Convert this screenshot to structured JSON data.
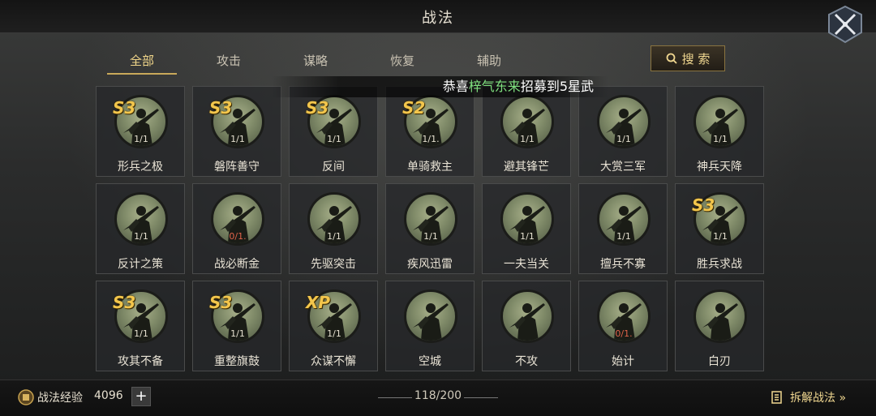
{
  "title": "战法",
  "tabs": [
    {
      "label": "全部",
      "active": true
    },
    {
      "label": "攻击",
      "active": false
    },
    {
      "label": "谋略",
      "active": false
    },
    {
      "label": "恢复",
      "active": false
    },
    {
      "label": "辅助",
      "active": false
    }
  ],
  "search_label": "搜 索",
  "notice": {
    "prefix": "恭喜",
    "highlight": "梓气东来",
    "suffix": "招募到5星武"
  },
  "skills": [
    {
      "name": "形兵之极",
      "count": "1/1",
      "badge": "S3",
      "red": false
    },
    {
      "name": "磐阵善守",
      "count": "1/1",
      "badge": "S3",
      "red": false
    },
    {
      "name": "反间",
      "count": "1/1",
      "badge": "S3",
      "red": false
    },
    {
      "name": "单骑救主",
      "count": "1/1.",
      "badge": "S2",
      "red": false
    },
    {
      "name": "避其锋芒",
      "count": "1/1",
      "badge": "",
      "red": false
    },
    {
      "name": "大赏三军",
      "count": "1/1",
      "badge": "",
      "red": false
    },
    {
      "name": "神兵天降",
      "count": "1/1",
      "badge": "",
      "red": false
    },
    {
      "name": "反计之策",
      "count": "1/1",
      "badge": "",
      "red": false
    },
    {
      "name": "战必断金",
      "count": "0/1.",
      "badge": "",
      "red": true
    },
    {
      "name": "先驱突击",
      "count": "1/1",
      "badge": "",
      "red": false
    },
    {
      "name": "疾风迅雷",
      "count": "1/1",
      "badge": "",
      "red": false
    },
    {
      "name": "一夫当关",
      "count": "1/1",
      "badge": "",
      "red": false
    },
    {
      "name": "擅兵不寡",
      "count": "1/1",
      "badge": "",
      "red": false
    },
    {
      "name": "胜兵求战",
      "count": "1/1",
      "badge": "S3",
      "red": false
    },
    {
      "name": "攻其不备",
      "count": "1/1",
      "badge": "S3",
      "red": false
    },
    {
      "name": "重整旗鼓",
      "count": "1/1",
      "badge": "S3",
      "red": false
    },
    {
      "name": "众谋不懈",
      "count": "1/1",
      "badge": "XP",
      "red": false
    },
    {
      "name": "空城",
      "count": "",
      "badge": "",
      "red": false
    },
    {
      "name": "不攻",
      "count": "",
      "badge": "",
      "red": false
    },
    {
      "name": "始计",
      "count": "0/1.",
      "badge": "",
      "red": true
    },
    {
      "name": "白刃",
      "count": "",
      "badge": "",
      "red": false
    }
  ],
  "footer": {
    "exp_label": "战法经验",
    "exp_value": "4096",
    "plus": "+",
    "capacity": "118/200",
    "dismantle": "拆解战法 »"
  }
}
